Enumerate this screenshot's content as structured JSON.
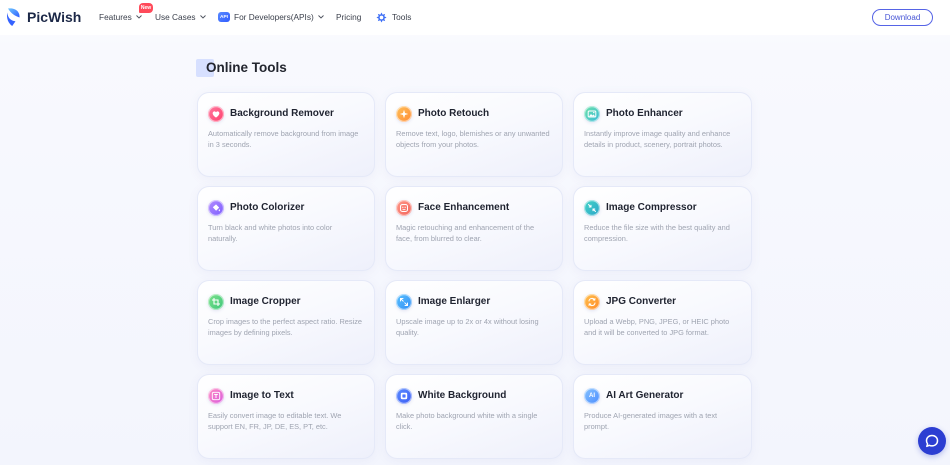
{
  "header": {
    "brand": "PicWish",
    "logo_icon": "picwish-logo-icon",
    "nav": [
      {
        "label": "Features",
        "badge": "New",
        "has_dropdown": true
      },
      {
        "label": "Use Cases",
        "has_dropdown": true
      },
      {
        "label": "For Developers(APIs)",
        "icon": "api-icon",
        "icon_text": "API",
        "has_dropdown": true
      },
      {
        "label": "Pricing",
        "has_dropdown": false
      },
      {
        "label": "Tools",
        "icon": "tools-icon",
        "has_dropdown": false
      }
    ],
    "download_label": "Download"
  },
  "main": {
    "title": "Online Tools",
    "tools": [
      {
        "title": "Background Remover",
        "description": "Automatically remove background from image in 3 seconds.",
        "icon": "background-remover-icon",
        "icon_colors": [
          "#ff7aa0",
          "#ff3f6c"
        ]
      },
      {
        "title": "Photo Retouch",
        "description": "Remove text, logo, blemishes or any unwanted objects from your photos.",
        "icon": "photo-retouch-icon",
        "icon_colors": [
          "#ffc25a",
          "#ff8a34"
        ]
      },
      {
        "title": "Photo Enhancer",
        "description": "Instantly improve image quality and enhance details in product, scenery, portrait photos.",
        "icon": "photo-enhancer-icon",
        "icon_colors": [
          "#6ee3a8",
          "#38b8d9"
        ]
      },
      {
        "title": "Photo Colorizer",
        "description": "Turn black and white photos into color naturally.",
        "icon": "photo-colorizer-icon",
        "icon_colors": [
          "#b48cff",
          "#7a5cff"
        ]
      },
      {
        "title": "Face Enhancement",
        "description": "Magic retouching and enhancement of the face, from blurred to clear.",
        "icon": "face-enhancement-icon",
        "icon_colors": [
          "#ff9a8a",
          "#f2625a"
        ]
      },
      {
        "title": "Image Compressor",
        "description": "Reduce the file size with the best quality and compression.",
        "icon": "image-compressor-icon",
        "icon_colors": [
          "#45d6c8",
          "#2aa3c9"
        ]
      },
      {
        "title": "Image Cropper",
        "description": "Crop images to the perfect aspect ratio. Resize images by defining pixels.",
        "icon": "image-cropper-icon",
        "icon_colors": [
          "#7ee38b",
          "#3cc47a"
        ]
      },
      {
        "title": "Image Enlarger",
        "description": "Upscale image up to 2x or 4x without losing quality.",
        "icon": "image-enlarger-icon",
        "icon_colors": [
          "#5bc2ff",
          "#2f8cf5"
        ]
      },
      {
        "title": "JPG Converter",
        "description": "Upload a Webp, PNG, JPEG, or HEIC photo and it will be converted to JPG format.",
        "icon": "jpg-converter-icon",
        "icon_colors": [
          "#ffc14d",
          "#ff8a2a"
        ]
      },
      {
        "title": "Image to Text",
        "description": "Easily convert image to editable text. We support EN, FR, JP, DE, ES, PT, etc.",
        "icon": "image-to-text-icon",
        "icon_colors": [
          "#ff8ac0",
          "#d85ce0"
        ]
      },
      {
        "title": "White Background",
        "description": "Make photo background white with a single click.",
        "icon": "white-background-icon",
        "icon_colors": [
          "#5b8cff",
          "#3b5cf5"
        ]
      },
      {
        "title": "AI Art Generator",
        "description": "Produce AI-generated images with a text prompt.",
        "icon": "ai-art-generator-icon",
        "icon_text": "AI",
        "icon_colors": [
          "#86c4ff",
          "#4b8cff"
        ]
      }
    ]
  },
  "chat": {
    "icon": "chat-bubble-icon"
  },
  "colors": {
    "accent": "#5664e6",
    "chat_button": "#2c3ed2",
    "badge": "#ff4a5a",
    "title_mark": "#d7e0ff"
  }
}
